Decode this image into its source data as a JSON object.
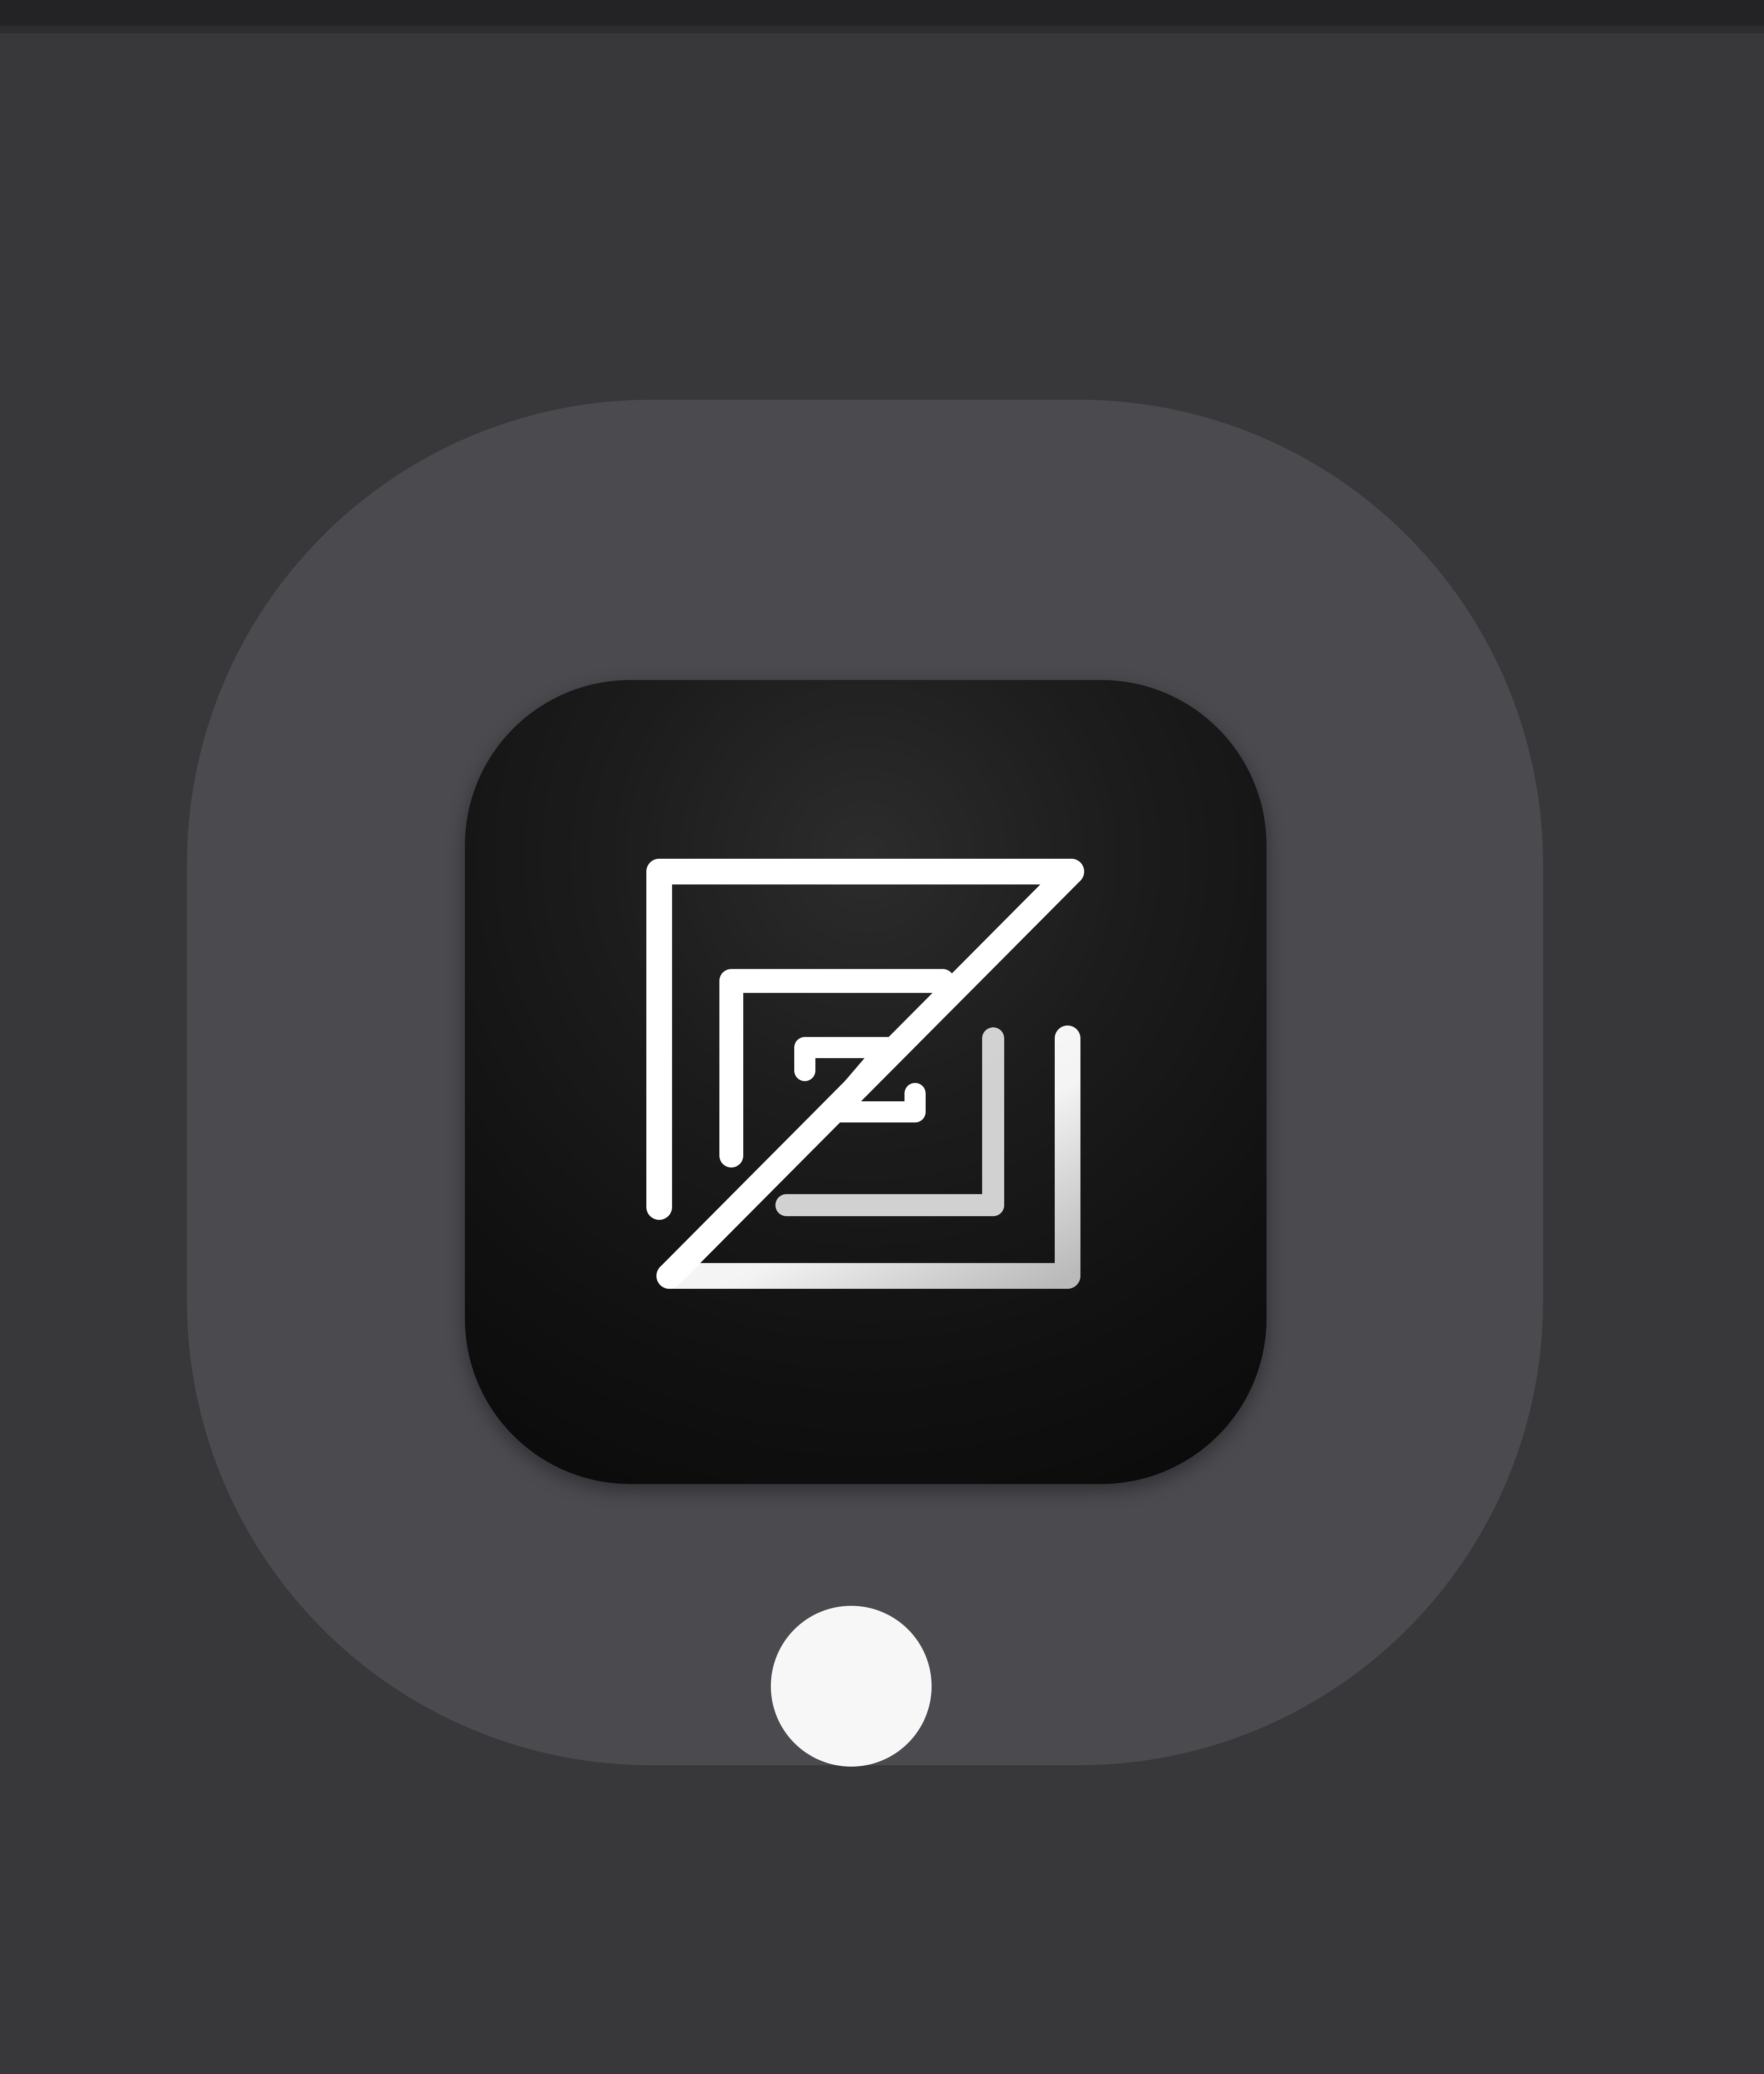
{
  "dock": {
    "items": [
      {
        "icon": "zed-logo-icon",
        "state": "running",
        "highlighted": true
      }
    ]
  },
  "colors": {
    "background": "#38383b",
    "top_edge": "#232326",
    "dock_item_highlight": "#4a4a4f",
    "icon_background": "#111111",
    "logo_stroke": "#ffffff",
    "running_indicator": "#f7f7f7"
  }
}
